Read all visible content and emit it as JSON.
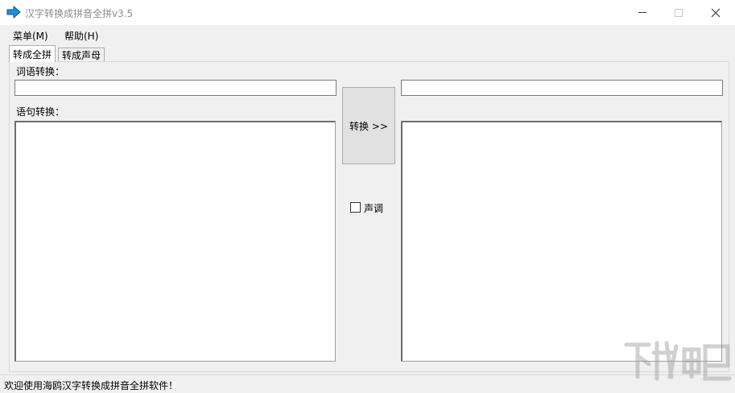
{
  "window": {
    "title": "汉字转换成拼音全拼v3.5",
    "icons": {
      "app": "blue-arrow-icon",
      "minimize": "minimize-icon",
      "maximize": "maximize-icon",
      "close": "close-icon"
    }
  },
  "menubar": {
    "items": [
      {
        "label": "菜单(M)"
      },
      {
        "label": "帮助(H)"
      }
    ]
  },
  "tabs": [
    {
      "label": "转成全拼",
      "active": true
    },
    {
      "label": "转成声母",
      "active": false
    }
  ],
  "main": {
    "word_label": "词语转换：",
    "word_input": "",
    "word_output": "",
    "sentence_label": "语句转换：",
    "sentence_input": "",
    "sentence_output": "",
    "convert_button": "转换 >>",
    "tone_checkbox": {
      "label": "声调",
      "checked": false
    }
  },
  "statusbar": {
    "text": "欢迎使用海鸥汉字转换成拼音全拼软件！"
  },
  "colors": {
    "window_bg": "#f0f0f0",
    "titlebar_bg": "#ffffff",
    "icon_blue": "#1e90e0",
    "button_bg": "#e1e1e1"
  }
}
